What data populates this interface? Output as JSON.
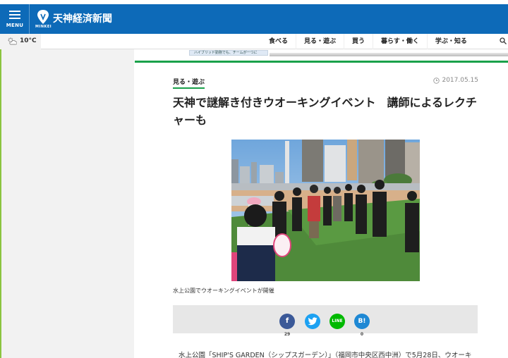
{
  "header": {
    "menu_label": "MENU",
    "logo_sub": "MINKEI",
    "logo_text": "天神経済新聞",
    "brand_color": "#0d6ab8"
  },
  "weather": {
    "temp": "10°C",
    "icon": "partly-cloudy-icon"
  },
  "nav": {
    "items": [
      "食べる",
      "見る・遊ぶ",
      "買う",
      "暮らす・働く",
      "学ぶ・知る"
    ]
  },
  "ad": {
    "text": "ハイブリッド勤務でも、チームが一つに"
  },
  "article": {
    "category": "見る・遊ぶ",
    "date": "2017.05.15",
    "title": "天神で謎解き付きウオーキングイベント　講師によるレクチャーも",
    "photo_caption": "水上公園でウオーキングイベントが開催",
    "body_start": "水上公園「SHIP'S GARDEN（シップスガーデン）」（福岡市中央区西中洲）で5月28日、ウオーキ",
    "accent_color": "#1aa14a"
  },
  "share": {
    "facebook_label": "f",
    "facebook_count": "29",
    "line_label": "LINE",
    "hatena_label": "B!",
    "hatena_count": "0"
  }
}
